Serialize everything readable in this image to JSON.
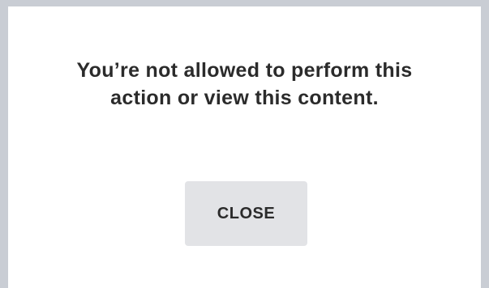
{
  "dialog": {
    "message": "You’re not allowed to perform this action or view this content.",
    "close_label": "CLOSE"
  },
  "colors": {
    "backdrop": "#c9cdd4",
    "dialog_background": "#ffffff",
    "button_background": "#e2e3e6",
    "text": "#2b2b2b"
  }
}
